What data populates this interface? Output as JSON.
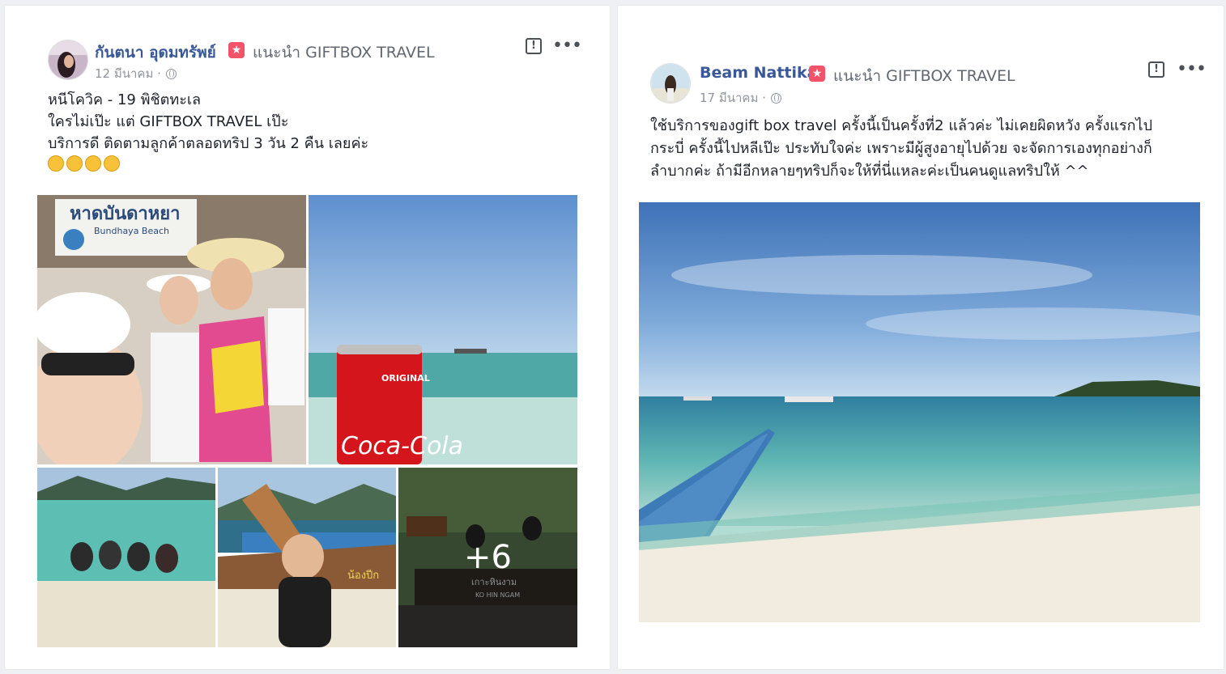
{
  "post1": {
    "author": "กันตนา อุดมทรัพย์",
    "recommends": "แนะนำ GIFTBOX TRAVEL",
    "date": "12 มีนาคม ·",
    "lines": [
      "หนีโควิค - 19 พิชิตทะเล",
      "ใครไม่เป๊ะ แต่ GIFTBOX TRAVEL เป๊ะ",
      "บริการดี ติดตามลูกค้าตลอดทริป 3 วัน 2 คืน เลยค่ะ"
    ],
    "emoji_count": 4,
    "photos": {
      "sign_top": "หาดบันดาหยา",
      "sign_sub": "Bundhaya Beach",
      "can_text": "ORIGINAL",
      "can_brand": "Coca-Cola",
      "boat_text": "น้องปีก",
      "rock_sign": "เกาะหินงาม",
      "rock_sign_en": "KO HIN NGAM",
      "more_count": "+6"
    }
  },
  "post2": {
    "author": "Beam Nattika",
    "recommends": "แนะนำ GIFTBOX TRAVEL",
    "date": "17 มีนาคม ·",
    "lines": [
      "ใช้บริการของgift box travel ครั้งนี้เป็นครั้งที่2 แล้วค่ะ ไม่เคยผิดหวัง ครั้งแรกไป",
      "กระบี่ ครั้งนี้ไปหลีเป๊ะ ประทับใจค่ะ เพราะมีผู้สูงอายุไปด้วย จะจัดการเองทุกอย่างก็",
      "ลำบากค่ะ ถ้ามีอีกหลายๆทริปก็จะให้ที่นี่แหละค่ะเป็นคนดูแลทริปให้ ^^"
    ]
  },
  "icons": {
    "star": "star-badge-icon",
    "globe": "globe-icon",
    "report": "report-icon",
    "more": "more-options-icon"
  },
  "colors": {
    "name": "#385898",
    "star_badge": "#f35369",
    "sea": "#5fb3b3",
    "sky": "#6b9fd4"
  }
}
